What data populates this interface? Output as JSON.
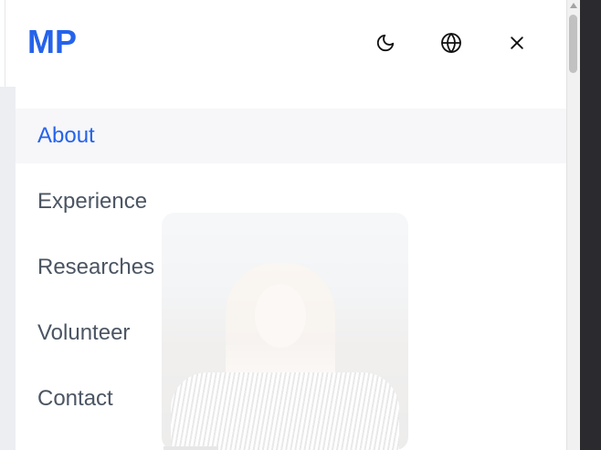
{
  "logo": {
    "text": "MP"
  },
  "header": {
    "icons": [
      "moon-icon",
      "globe-icon",
      "close-icon"
    ]
  },
  "nav": {
    "items": [
      {
        "label": "About",
        "active": true
      },
      {
        "label": "Experience",
        "active": false
      },
      {
        "label": "Researches",
        "active": false
      },
      {
        "label": "Volunteer",
        "active": false
      },
      {
        "label": "Contact",
        "active": false
      }
    ]
  },
  "colors": {
    "accent": "#2563eb",
    "nav_text": "#4b5563",
    "active_bg": "#f3f4f6"
  }
}
